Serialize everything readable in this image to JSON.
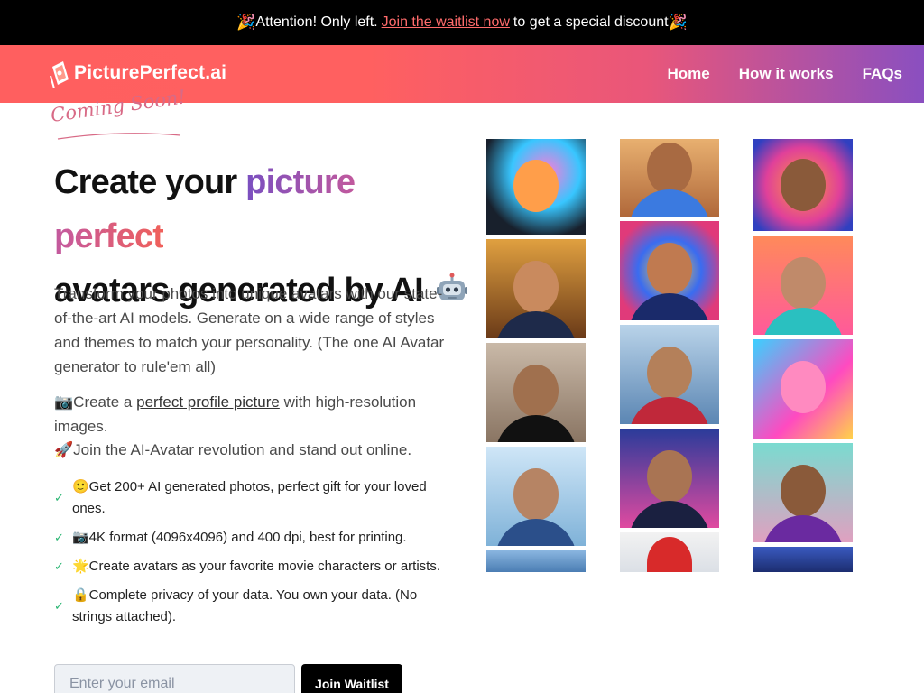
{
  "announcement": {
    "prefix": "Attention! Only left.",
    "link": "Join the waitlist now",
    "suffix": "to get a special discount",
    "emoji": "🎉"
  },
  "nav": {
    "logo_text": "PicturePerfect.ai",
    "links": [
      "Home",
      "How it works",
      "FAQs"
    ]
  },
  "hero": {
    "coming_soon": "Coming Soon!",
    "headline_1": "Create your",
    "headline_highlight": "picture perfect",
    "headline_2": "avatars generated by AI",
    "description": "Transform your photos into unique avatars with our state-of-the-art AI models. Generate on a wide range of styles and themes to match your personality. (The one AI Avatar generator to rule'em all)",
    "feature1_prefix": "📷Create a",
    "feature1_link": "perfect profile picture",
    "feature1_suffix": "with high-resolution images.",
    "feature2": "🚀Join the AI-Avatar revolution and stand out online."
  },
  "checklist": [
    "🙂Get 200+ AI generated photos, perfect gift for your loved ones.",
    "📷4K format (4096x4096) and 400 dpi, best for printing.",
    "🌟Create avatars as your favorite movie characters or artists.",
    "🔒Complete privacy of your data. You own your data. (No strings attached)."
  ],
  "form": {
    "email_placeholder": "Enter your email",
    "button": "Join Waitlist"
  },
  "colors": {
    "accent_red": "#ff5f5f",
    "accent_purple": "#8a4fc0",
    "check_green": "#2bb673"
  }
}
